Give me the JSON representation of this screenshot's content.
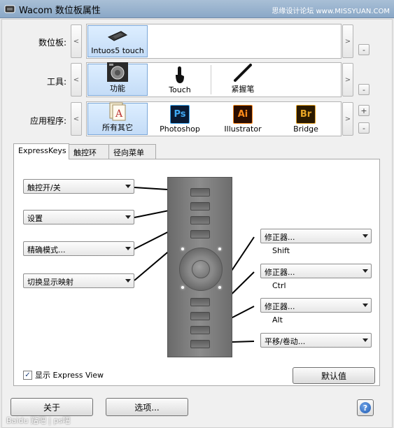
{
  "window": {
    "title": "Wacom 数位板属性",
    "watermark": "思缘设计论坛 www.MISSYUAN.COM"
  },
  "rows": {
    "tablet": {
      "label": "数位板:",
      "items": [
        {
          "label": "Intuos5 touch",
          "icon": "tablet-icon",
          "selected": true
        }
      ]
    },
    "tool": {
      "label": "工具:",
      "items": [
        {
          "label": "功能",
          "icon": "express-functions-icon",
          "selected": true
        },
        {
          "label": "Touch",
          "icon": "touch-finger-icon",
          "selected": false
        },
        {
          "label": "紧握笔",
          "icon": "grip-pen-icon",
          "selected": false
        }
      ]
    },
    "app": {
      "label": "应用程序:",
      "items": [
        {
          "label": "所有其它",
          "icon": "all-other-apps-icon",
          "selected": true
        },
        {
          "label": "Photoshop",
          "icon": "photoshop-icon",
          "badge": "Ps",
          "selected": false
        },
        {
          "label": "Illustrator",
          "icon": "illustrator-icon",
          "badge": "Ai",
          "selected": false
        },
        {
          "label": "Bridge",
          "icon": "bridge-icon",
          "badge": "Br",
          "selected": false
        }
      ]
    }
  },
  "nav": {
    "prev": "<",
    "next": ">",
    "add": "+",
    "remove": "-"
  },
  "tabs": [
    {
      "label": "ExpressKeys",
      "active": true
    },
    {
      "label": "触控环",
      "active": false
    },
    {
      "label": "径向菜单",
      "active": false
    }
  ],
  "left_keys": [
    "触控开/关",
    "设置",
    "精确模式...",
    "切换显示映射"
  ],
  "right_keys": [
    {
      "value": "修正器...",
      "label": "Shift"
    },
    {
      "value": "修正器...",
      "label": "Ctrl"
    },
    {
      "value": "修正器...",
      "label": "Alt"
    },
    {
      "value": "平移/卷动...",
      "label": ""
    }
  ],
  "express_view": {
    "label": "显示 Express View",
    "checked": true,
    "mark": "✓"
  },
  "buttons": {
    "default": "默认值",
    "about": "关于",
    "options": "选项...",
    "help": "?"
  },
  "footer_watermark": "Baidu 贴吧 | ps吧",
  "colors": {
    "selected_bg": "#c4dcf7",
    "selected_border": "#7ba7d8",
    "title_bar": "#8aa8c7"
  }
}
